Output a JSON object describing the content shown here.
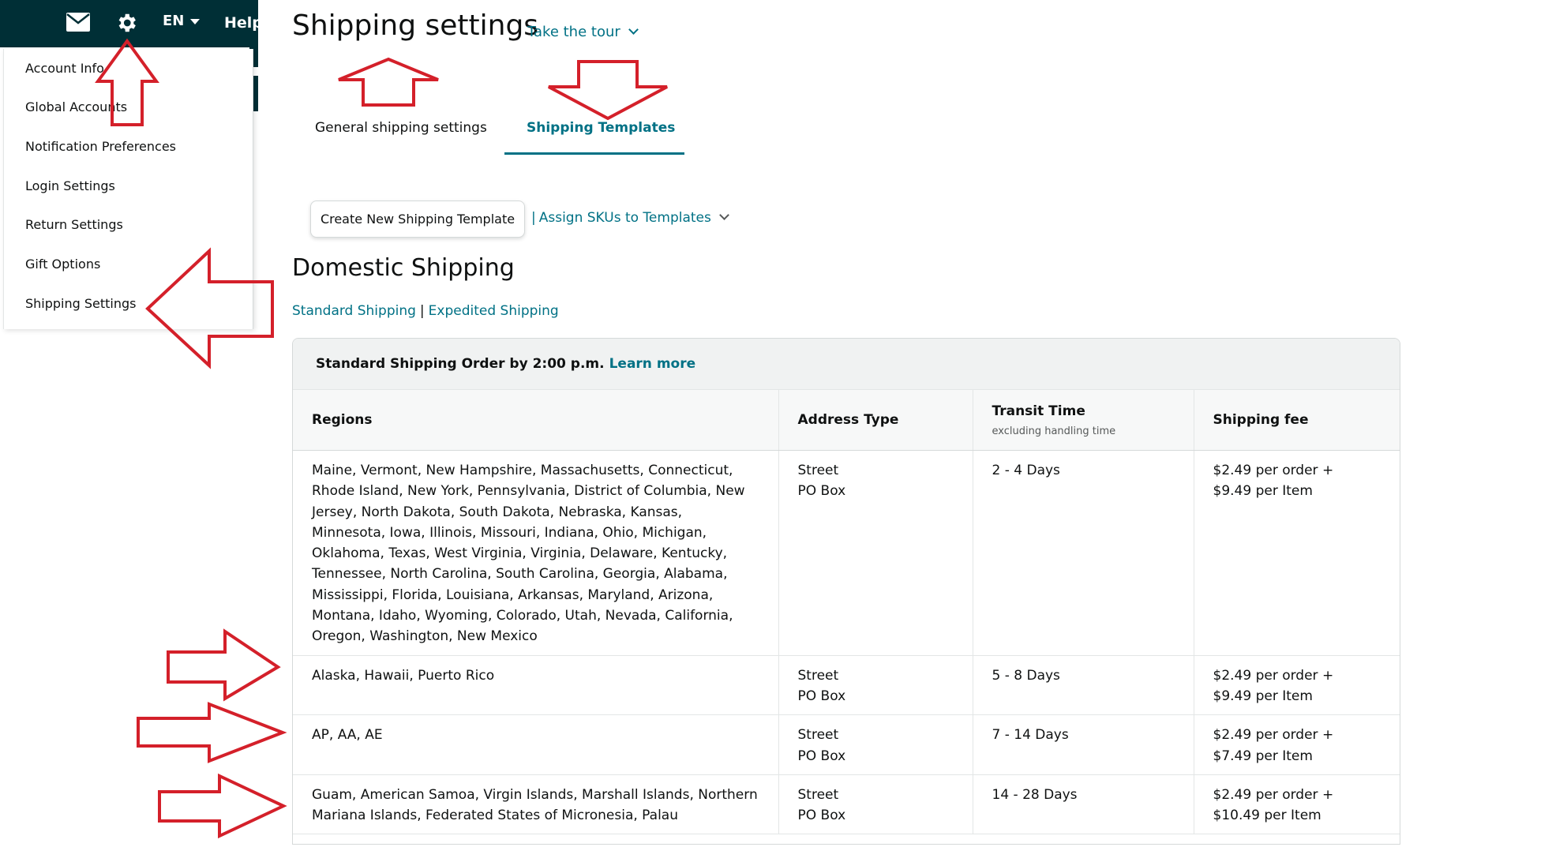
{
  "topnav": {
    "language": "EN",
    "help": "Help"
  },
  "menu": {
    "items": [
      "Account Info",
      "Global Accounts",
      "Notification Preferences",
      "Login Settings",
      "Return Settings",
      "Gift Options",
      "Shipping Settings"
    ]
  },
  "page": {
    "title": "Shipping settings",
    "tour_link": "Take the tour"
  },
  "tabs": [
    {
      "label": "General shipping settings",
      "active": false
    },
    {
      "label": "Shipping Templates",
      "active": true
    }
  ],
  "actions": {
    "create_button": "Create New Shipping Template",
    "assign_link": "Assign SKUs to Templates",
    "assign_separator": "|"
  },
  "section": {
    "title": "Domestic Shipping",
    "links": [
      "Standard Shipping",
      "Expedited Shipping"
    ],
    "link_separator": "|"
  },
  "card": {
    "heading": "Standard Shipping Order by 2:00 p.m.",
    "learn_more": "Learn more"
  },
  "table": {
    "headers": {
      "regions": "Regions",
      "address_type": "Address Type",
      "transit_time": "Transit Time",
      "transit_sub": "excluding handling time",
      "shipping_fee": "Shipping fee"
    },
    "rows": [
      {
        "regions": "Maine, Vermont, New Hampshire, Massachusetts, Connecticut, Rhode Island, New York, Pennsylvania, District of Columbia, New Jersey, North Dakota, South Dakota, Nebraska, Kansas, Minnesota, Iowa, Illinois, Missouri, Indiana, Ohio, Michigan, Oklahoma, Texas, West Virginia, Virginia, Delaware, Kentucky, Tennessee, North Carolina, South Carolina, Georgia, Alabama, Mississippi, Florida, Louisiana, Arkansas, Maryland, Arizona, Montana, Idaho, Wyoming, Colorado, Utah, Nevada, California, Oregon, Washington, New Mexico",
        "address_1": "Street",
        "address_2": "PO Box",
        "transit": "2 - 4 Days",
        "fee_1": "$2.49 per order +",
        "fee_2": "$9.49 per Item"
      },
      {
        "regions": "Alaska, Hawaii, Puerto Rico",
        "address_1": "Street",
        "address_2": "PO Box",
        "transit": "5 - 8 Days",
        "fee_1": "$2.49 per order +",
        "fee_2": "$9.49 per Item"
      },
      {
        "regions": "AP, AA, AE",
        "address_1": "Street",
        "address_2": "PO Box",
        "transit": "7 - 14 Days",
        "fee_1": "$2.49 per order +",
        "fee_2": "$7.49 per Item"
      },
      {
        "regions": "Guam, American Samoa, Virgin Islands, Marshall Islands, Northern Mariana Islands, Federated States of Micronesia, Palau",
        "address_1": "Street",
        "address_2": "PO Box",
        "transit": "14 - 28 Days",
        "fee_1": "$2.49 per order +",
        "fee_2": "$10.49 per Item"
      }
    ]
  },
  "colors": {
    "nav_bg": "#002f36",
    "link": "#007185",
    "annotation": "#d4202a"
  }
}
